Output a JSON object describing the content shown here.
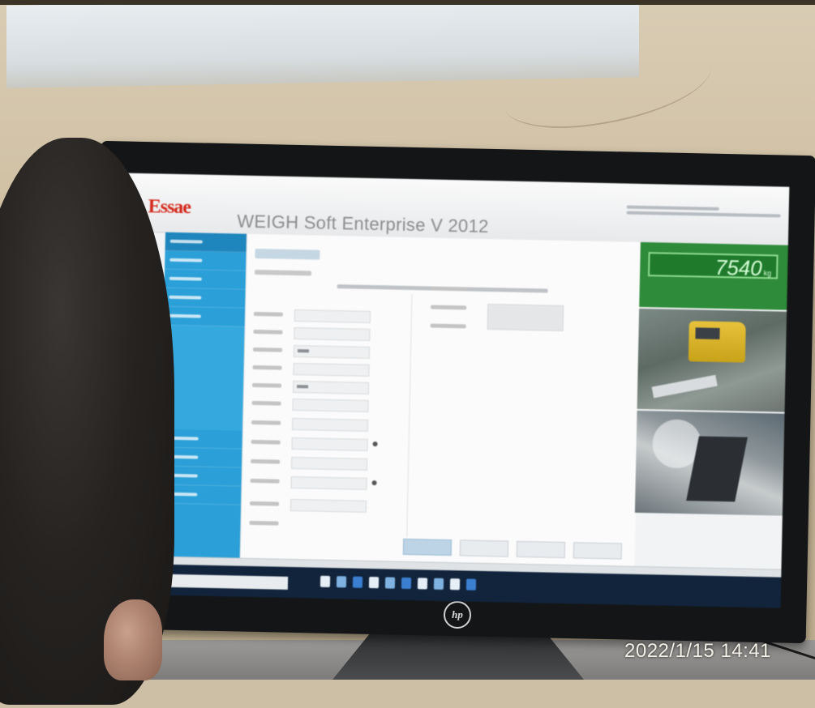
{
  "app": {
    "brand": "Essae",
    "title": "WEIGH Soft Enterprise V 2012"
  },
  "weight": {
    "value": "7540",
    "unit": "kg"
  },
  "photo": {
    "timestamp": "2022/1/15 14:41",
    "monitor_brand": "hp"
  },
  "colors": {
    "brand_red": "#d42a1e",
    "sidebar_blue": "#2a9fd8",
    "weight_green": "#2e8b3a",
    "taskbar_navy": "#11243c"
  },
  "icons": [
    "search-icon",
    "task-view-icon",
    "explorer-icon",
    "browser-icon",
    "app-icon"
  ]
}
